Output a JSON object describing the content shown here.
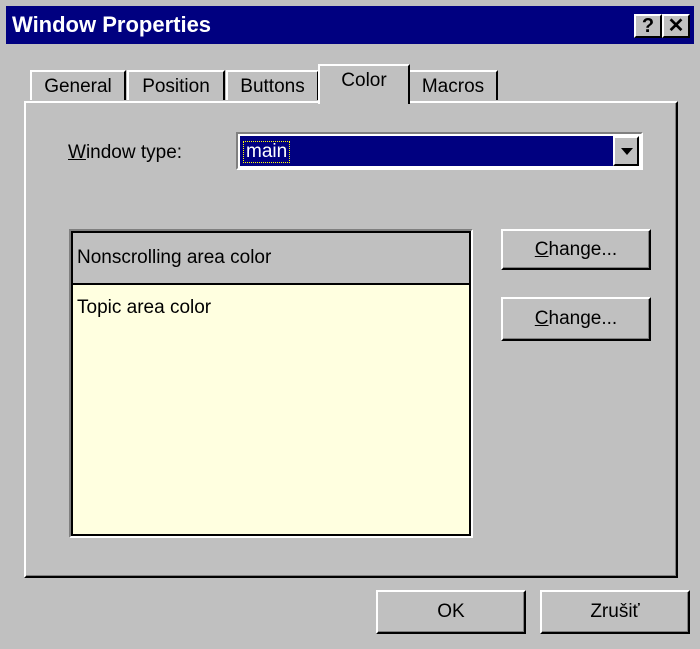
{
  "window": {
    "title": "Window Properties"
  },
  "titlebar": {
    "help_label": "?",
    "close_label": "✕"
  },
  "tabs": [
    {
      "label": "General"
    },
    {
      "label": "Position"
    },
    {
      "label": "Buttons"
    },
    {
      "label": "Color"
    },
    {
      "label": "Macros"
    }
  ],
  "active_tab": "Color",
  "window_type": {
    "label_first": "W",
    "label_rest": "indow type:",
    "value": "main"
  },
  "preview": {
    "nonscrolling_label": "Nonscrolling area color",
    "topic_label": "Topic area color",
    "nonscrolling_color": "#c0c0c0",
    "topic_color": "#ffffe0"
  },
  "buttons": {
    "change_first": "C",
    "change_rest": "hange...",
    "ok": "OK",
    "cancel": "Zrušiť"
  },
  "colors": {
    "titlebar": "#000080",
    "face": "#c0c0c0",
    "selection": "#000080"
  }
}
